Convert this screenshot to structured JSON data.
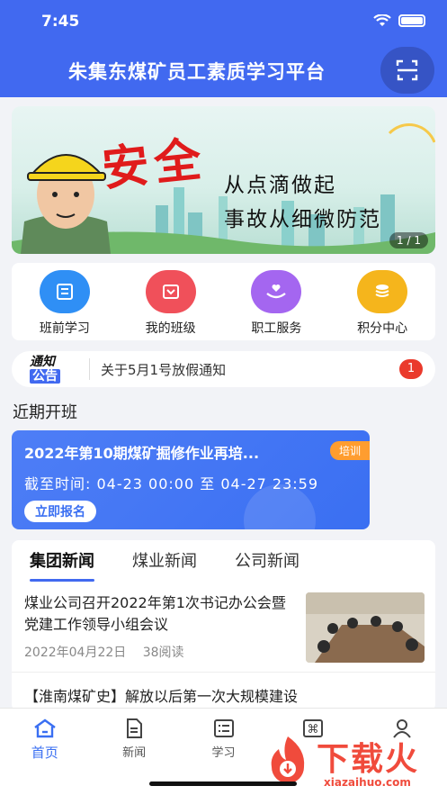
{
  "status_bar": {
    "time": "7:45"
  },
  "header": {
    "title": "朱集东煤矿员工素质学习平台",
    "scan_icon": "scan-icon"
  },
  "banner": {
    "slogan_big": "安全",
    "line1": "从点滴做起",
    "line2": "事故从细微防范",
    "page_indicator": "1 / 1"
  },
  "quick_actions": [
    {
      "label": "班前学习",
      "icon": "calendar-icon",
      "color": "#2f8ff5"
    },
    {
      "label": "我的班级",
      "icon": "class-icon",
      "color": "#f0505a"
    },
    {
      "label": "职工服务",
      "icon": "hands-heart-icon",
      "color": "#a466f0"
    },
    {
      "label": "积分中心",
      "icon": "coins-icon",
      "color": "#f5b51c"
    }
  ],
  "notice": {
    "tag_line1": "通知",
    "tag_line2": "公告",
    "text": "关于5月1号放假通知",
    "badge": "1"
  },
  "recent_classes": {
    "title": "近期开班",
    "card": {
      "title": "2022年第10期煤矿掘修作业再培...",
      "tag": "培训",
      "time": "截至时间: 04-23 00:00 至 04-27 23:59",
      "button": "立即报名"
    }
  },
  "news": {
    "tabs": [
      "集团新闻",
      "煤业新闻",
      "公司新闻"
    ],
    "active_tab": 0,
    "items": [
      {
        "title": "煤业公司召开2022年第1次书记办公会暨党建工作领导小组会议",
        "date": "2022年04月22日",
        "reads": "38阅读"
      },
      {
        "title": "【淮南煤矿史】解放以后第一次大规模建设"
      }
    ]
  },
  "bottom_nav": [
    {
      "label": "首页",
      "icon": "home-icon",
      "active": true
    },
    {
      "label": "新闻",
      "icon": "document-icon",
      "active": false
    },
    {
      "label": "学习",
      "icon": "list-icon",
      "active": false
    },
    {
      "label": "",
      "icon": "command-icon",
      "active": false
    },
    {
      "label": "",
      "icon": "user-icon",
      "active": false
    }
  ],
  "watermark": {
    "text": "下载火",
    "url": "xiazaihuo.com"
  },
  "colors": {
    "primary": "#4169f0",
    "badge": "#ea3a2c",
    "tag": "#ff9d2f"
  }
}
